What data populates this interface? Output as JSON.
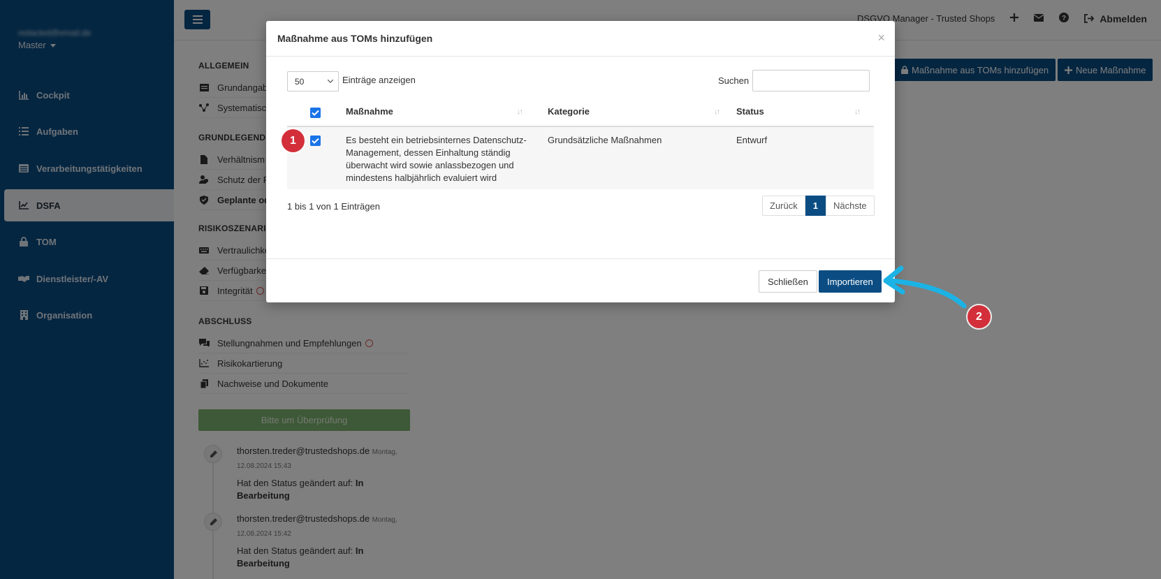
{
  "sidebar": {
    "user_email": "redacted@email.de",
    "tenant": "Master",
    "items": [
      {
        "label": "Cockpit",
        "icon": "chart-bar-icon"
      },
      {
        "label": "Aufgaben",
        "icon": "list-icon"
      },
      {
        "label": "Verarbeitungstätigkeiten",
        "icon": "table-icon"
      },
      {
        "label": "DSFA",
        "icon": "line-chart-icon"
      },
      {
        "label": "TOM",
        "icon": "lock-icon"
      },
      {
        "label": "Dienstleister/-AV",
        "icon": "handshake-icon"
      },
      {
        "label": "Organisation",
        "icon": "building-icon"
      }
    ]
  },
  "topbar": {
    "brand": "DSGVO Manager - Trusted Shops",
    "logout": "Abmelden"
  },
  "page": {
    "sections": {
      "allgemein": "ALLGEMEIN",
      "grundlegende": "GRUNDLEGENDE F",
      "risiko": "RISIKOSZENARIEN",
      "abschluss": "ABSCHLUSS"
    },
    "links": {
      "grundangaben": "Grundangab",
      "systematisch": "Systematisc",
      "verhaeltnis": "Verhältnism",
      "schutz": "Schutz der F",
      "geplante": "Geplante od",
      "vertraulichkeit": "Vertraulichke",
      "verfuegbarkeit": "Verfügbarke",
      "integritaet": "Integrität",
      "stellungnahmen": "Stellungnahmen und Empfehlungen",
      "risikokartierung": "Risikokartierung",
      "nachweise": "Nachweise und Dokumente"
    },
    "review_button": "Bitte um Überprüfung",
    "actions": {
      "add_from_toms": "Maßnahme aus TOMs hinzufügen",
      "new_measure": "Neue Maßnahme"
    },
    "timeline": [
      {
        "email": "thorsten.treder@trustedshops.de",
        "day": "Montag,",
        "date": "12.08.2024 15:43",
        "msg_prefix": "Hat den Status geändert auf:",
        "msg_status": "In Bearbeitung"
      },
      {
        "email": "thorsten.treder@trustedshops.de",
        "day": "Montag,",
        "date": "12.08.2024 15:42",
        "msg_prefix": "Hat den Status geändert auf:",
        "msg_status": "In Bearbeitung"
      }
    ]
  },
  "modal": {
    "title": "Maßnahme aus TOMs hinzufügen",
    "close_symbol": "×",
    "length_value": "50",
    "length_label": "Einträge anzeigen",
    "search_label": "Suchen",
    "search_value": "",
    "columns": {
      "measure": "Maßnahme",
      "category": "Kategorie",
      "status": "Status"
    },
    "rows": [
      {
        "checked": true,
        "measure": "Es besteht ein betriebsinternes Datenschutz-Management, dessen Einhaltung ständig überwacht wird sowie anlassbezogen und mindestens halbjährlich evaluiert wird",
        "category": "Grundsätzliche Maßnahmen",
        "status": "Entwurf"
      }
    ],
    "info": "1 bis 1 von 1 Einträgen",
    "pager": {
      "prev": "Zurück",
      "current": "1",
      "next": "Nächste"
    },
    "footer": {
      "close": "Schließen",
      "import": "Importieren"
    }
  },
  "annotations": {
    "step1": "1",
    "step2": "2",
    "badge_color": "#d32f3a",
    "arrow_color": "#1bb3e6"
  }
}
